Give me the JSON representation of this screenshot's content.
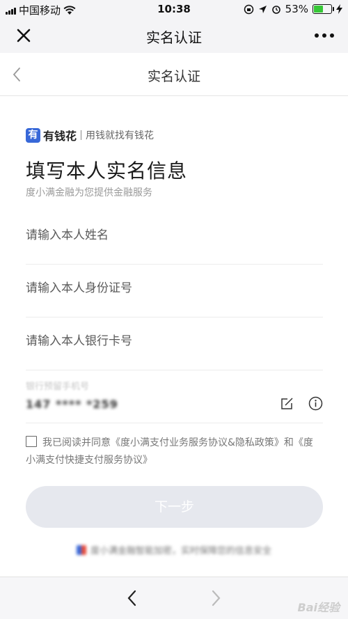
{
  "status_bar": {
    "carrier": "中国移动",
    "time": "10:38",
    "battery_percent": "53%",
    "battery_level": 0.53
  },
  "title_bar": {
    "title": "实名认证"
  },
  "page_header": {
    "title": "实名认证"
  },
  "brand": {
    "logo_char": "有",
    "name": "有钱花",
    "slogan": "用钱就找有钱花"
  },
  "form": {
    "title": "填写本人实名信息",
    "subtitle": "度小满金融为您提供金融服务",
    "name_placeholder": "请输入本人姓名",
    "id_placeholder": "请输入本人身份证号",
    "card_placeholder": "请输入本人银行卡号",
    "phone_label": "银行预留手机号",
    "phone_value": "147 **** *259"
  },
  "agreement": {
    "checked": false,
    "text": "我已阅读并同意《度小满支付业务服务协议&隐私政策》和《度",
    "text2": "小满支付快捷支付服务协议》"
  },
  "next_button": {
    "label": "下一步"
  },
  "footer": {
    "note": "度小满金融智能加密，实时保障您的信息安全"
  },
  "watermark": {
    "text": "Bai经验"
  },
  "colors": {
    "brand_blue": "#3868d8",
    "button_disabled": "#e6e8ee",
    "battery_green": "#37c837"
  }
}
